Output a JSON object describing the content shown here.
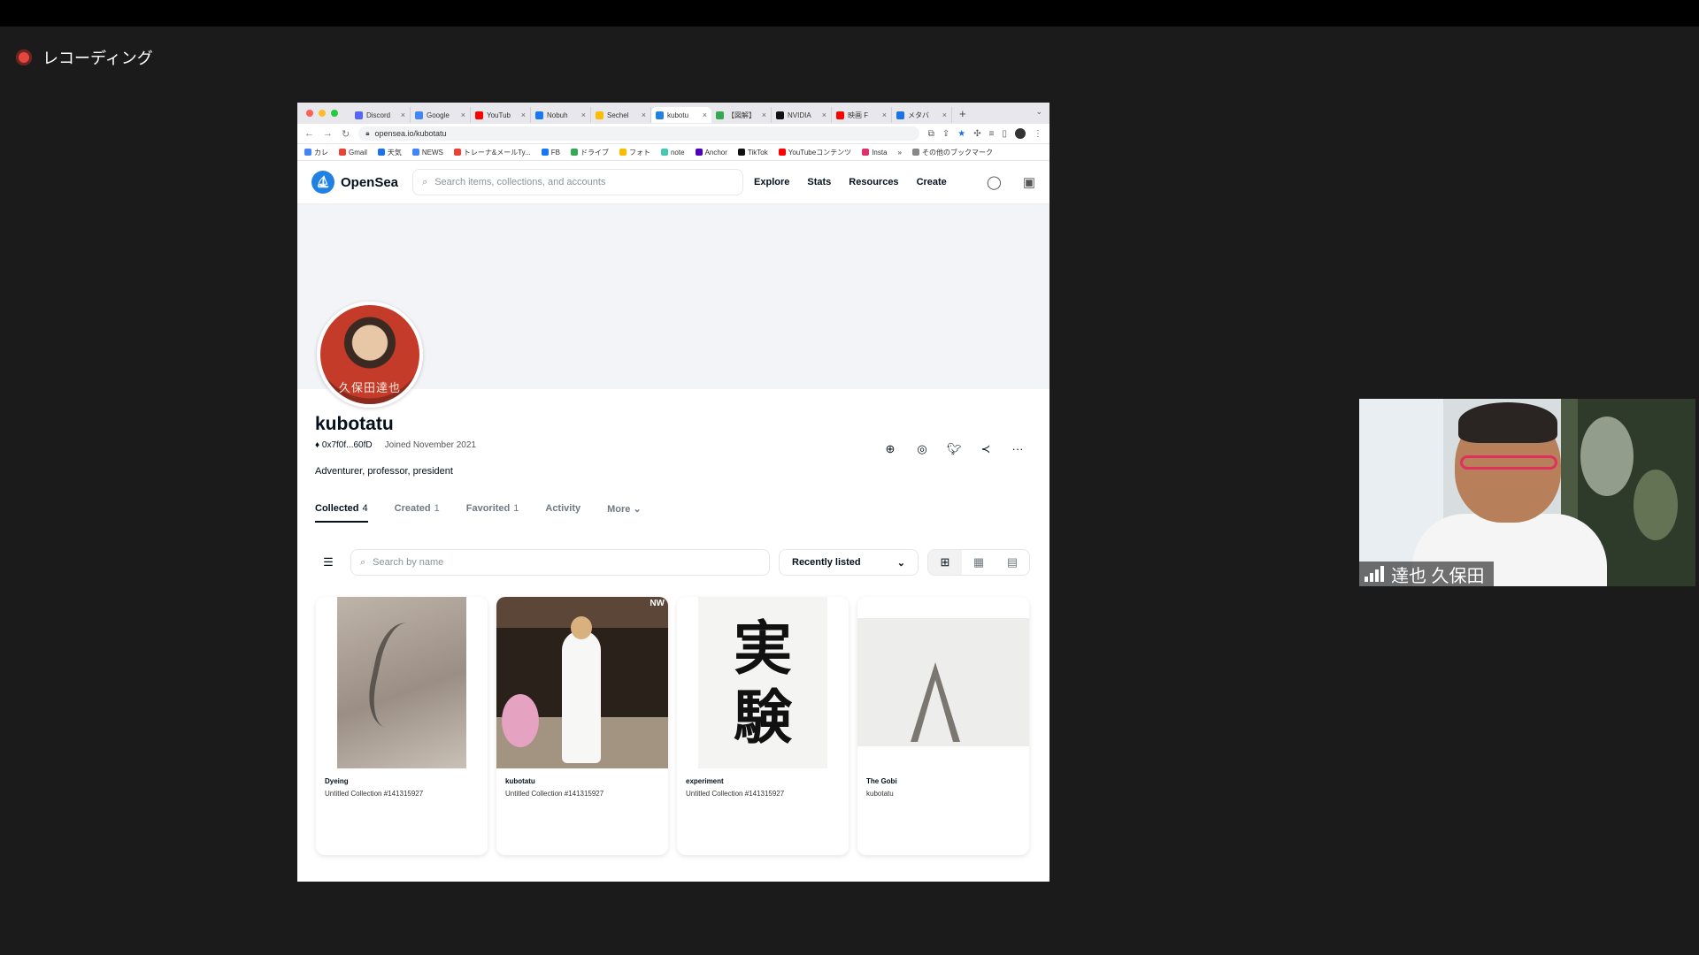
{
  "recording": {
    "label": "レコーディング"
  },
  "browser": {
    "tabs": [
      {
        "label": "Discord",
        "color": "#5865f2"
      },
      {
        "label": "Google",
        "color": "#4285f4"
      },
      {
        "label": "YouTub",
        "color": "#ff0000"
      },
      {
        "label": "Nobuh",
        "color": "#1877f2"
      },
      {
        "label": "Sechel",
        "color": "#fbbc04"
      },
      {
        "label": "kubotu",
        "color": "#2081e2",
        "active": true
      },
      {
        "label": "【図解】",
        "color": "#34a853"
      },
      {
        "label": "NVIDIA",
        "color": "#111111"
      },
      {
        "label": "映画 F",
        "color": "#ff0000"
      },
      {
        "label": "メタバ",
        "color": "#1a73e8"
      }
    ],
    "url": "opensea.io/kubotatu",
    "bookmarks": [
      {
        "label": "カレ",
        "color": "#4285f4"
      },
      {
        "label": "Gmail",
        "color": "#ea4335"
      },
      {
        "label": "天気",
        "color": "#1a73e8"
      },
      {
        "label": "NEWS",
        "color": "#4285f4"
      },
      {
        "label": "トレーナ&メールTy...",
        "color": "#ea4335"
      },
      {
        "label": "FB",
        "color": "#1877f2"
      },
      {
        "label": "ドライブ",
        "color": "#34a853"
      },
      {
        "label": "フォト",
        "color": "#fbbc04"
      },
      {
        "label": "note",
        "color": "#41c9b4"
      },
      {
        "label": "Anchor",
        "color": "#5000b9"
      },
      {
        "label": "TikTok",
        "color": "#111111"
      },
      {
        "label": "YouTubeコンテンツ",
        "color": "#ff0000"
      },
      {
        "label": "Insta",
        "color": "#e1306c"
      },
      {
        "label": "その他のブックマーク",
        "color": "#888888"
      }
    ]
  },
  "opensea": {
    "brand": "OpenSea",
    "search_placeholder": "Search items, collections, and accounts",
    "menu": [
      "Explore",
      "Stats",
      "Resources",
      "Create"
    ],
    "profile": {
      "avatar_caption": "久保田達也",
      "username": "kubotatu",
      "address": "0x7f0f...60fD",
      "joined": "Joined November 2021",
      "bio": "Adventurer, professor, president"
    },
    "tabs": [
      {
        "label": "Collected",
        "count": "4",
        "active": true
      },
      {
        "label": "Created",
        "count": "1"
      },
      {
        "label": "Favorited",
        "count": "1"
      },
      {
        "label": "Activity",
        "count": ""
      },
      {
        "label": "More",
        "count": ""
      }
    ],
    "name_search_placeholder": "Search by name",
    "sort_label": "Recently listed",
    "items": [
      {
        "title": "Dyeing",
        "collection": "Untitled Collection #141315927"
      },
      {
        "title": "kubotatu",
        "collection": "Untitled Collection #141315927"
      },
      {
        "title": "experiment",
        "collection": "Untitled Collection #141315927"
      },
      {
        "title": "The Gobi",
        "collection": "kubotatu"
      }
    ],
    "calligraphy": [
      "実",
      "験"
    ],
    "badge": "NW"
  },
  "webcam": {
    "name": "達也 久保田"
  }
}
